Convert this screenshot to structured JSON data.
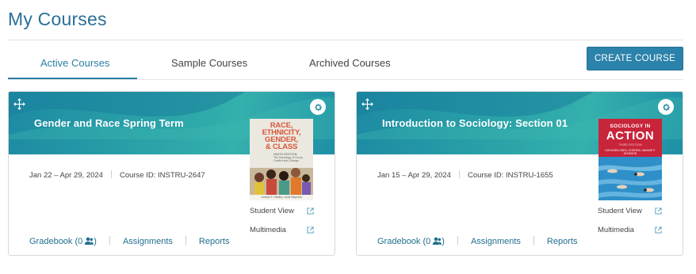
{
  "page": {
    "title": "My Courses"
  },
  "tabs": [
    {
      "label": "Active Courses",
      "active": true
    },
    {
      "label": "Sample Courses",
      "active": false
    },
    {
      "label": "Archived Courses",
      "active": false
    }
  ],
  "create_button": {
    "label": "CREATE COURSE"
  },
  "colors": {
    "accent": "#2a7fa5",
    "button": "#2b82aa",
    "banner": "#2aa3a8",
    "link": "#1f6f8f"
  },
  "courses": [
    {
      "title": "Gender and Race Spring Term",
      "dates": "Jan 22 – Apr 29, 2024",
      "course_id": "Course ID: INSTRU-2647",
      "student_view": "Student View",
      "multimedia": "Multimedia",
      "gradebook": "Gradebook (0",
      "gradebook_close": ")",
      "assignments": "Assignments",
      "reports": "Reports",
      "book": {
        "title_lines": [
          "RACE,",
          "ETHNICITY,",
          "GENDER,",
          "& CLASS"
        ],
        "edition": "NINTH EDITION",
        "subtitle": "The Sociology of Group Conflict and Change",
        "authors": "Joseph F. Healey • Andi Stepnick"
      }
    },
    {
      "title": "Introduction to Sociology: Section 01",
      "dates": "Jan 15 – Apr 29, 2024",
      "course_id": "Course ID: INSTRU-1655",
      "student_view": "Student View",
      "multimedia": "Multimedia",
      "gradebook": "Gradebook (0",
      "gradebook_close": ")",
      "assignments": "Assignments",
      "reports": "Reports",
      "book": {
        "title_top": "SOCIOLOGY IN",
        "title_main": "ACTION",
        "edition": "THIRD EDITION",
        "authors": "KATHLEEN ODELL KORGEN • MAXINE P. ATKINSON"
      }
    }
  ]
}
